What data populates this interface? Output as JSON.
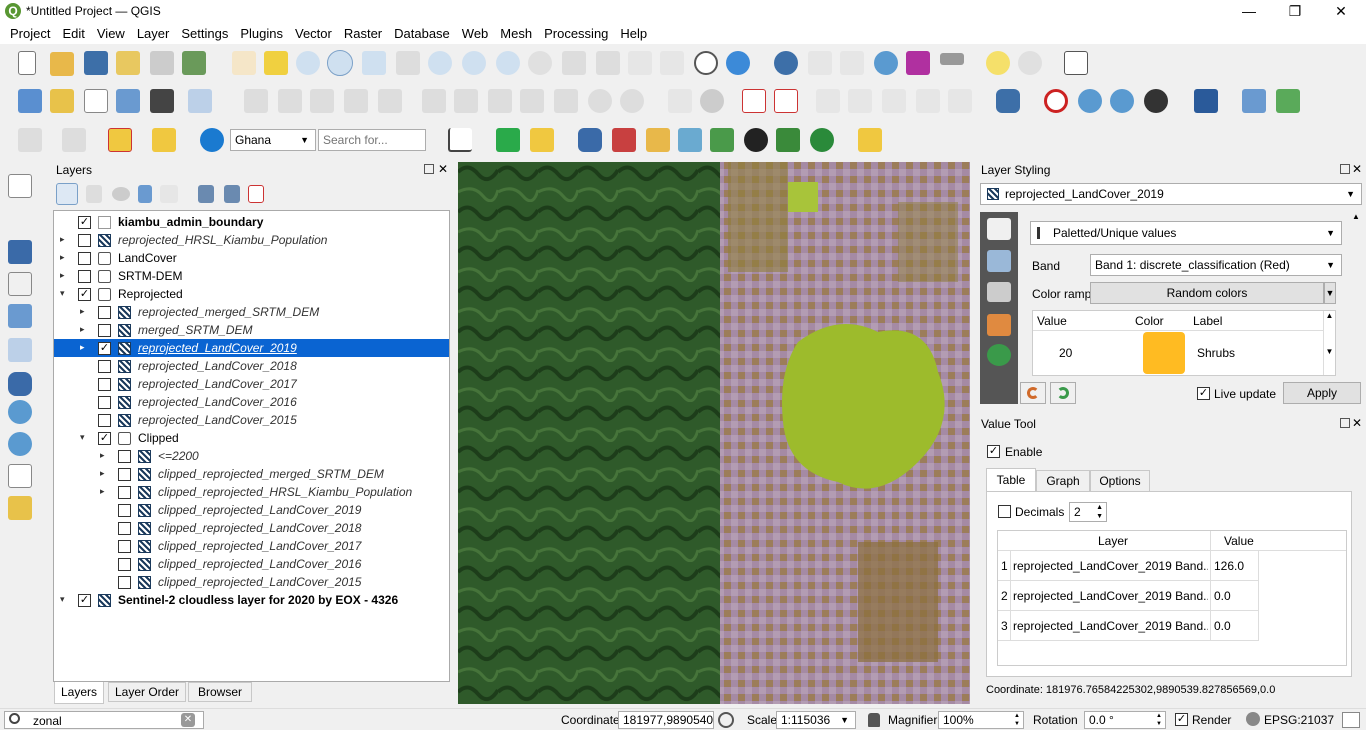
{
  "window": {
    "title": "*Untitled Project — QGIS",
    "logo_letter": "Q",
    "minimize": "—",
    "maximize": "❐",
    "close": "✕"
  },
  "menu": [
    "Project",
    "Edit",
    "View",
    "Layer",
    "Settings",
    "Plugins",
    "Vector",
    "Raster",
    "Database",
    "Web",
    "Mesh",
    "Processing",
    "Help"
  ],
  "toolbar3": {
    "locator_combo": "Ghana",
    "search_placeholder": "Search for..."
  },
  "layers_panel": {
    "title": "Layers",
    "rows": [
      {
        "label": "kiambu_admin_boundary",
        "checked": true,
        "bold": true,
        "italic": false,
        "indent": 0,
        "arrow": "",
        "icon": "vector"
      },
      {
        "label": "reprojected_HRSL_Kiambu_Population",
        "checked": false,
        "bold": false,
        "italic": true,
        "indent": 0,
        "arrow": "▸",
        "icon": "raster"
      },
      {
        "label": "LandCover",
        "checked": false,
        "bold": false,
        "italic": false,
        "indent": 0,
        "arrow": "▸",
        "icon": "group"
      },
      {
        "label": "SRTM-DEM",
        "checked": false,
        "bold": false,
        "italic": false,
        "indent": 0,
        "arrow": "▸",
        "icon": "group"
      },
      {
        "label": "Reprojected",
        "checked": true,
        "bold": false,
        "italic": false,
        "indent": 0,
        "arrow": "▾",
        "icon": "group"
      },
      {
        "label": "reprojected_merged_SRTM_DEM",
        "checked": false,
        "bold": false,
        "italic": true,
        "indent": 1,
        "arrow": "▸",
        "icon": "raster"
      },
      {
        "label": "merged_SRTM_DEM",
        "checked": false,
        "bold": false,
        "italic": true,
        "indent": 1,
        "arrow": "▸",
        "icon": "raster"
      },
      {
        "label": "reprojected_LandCover_2019",
        "checked": true,
        "bold": false,
        "italic": true,
        "indent": 1,
        "arrow": "▸",
        "icon": "raster",
        "selected": true
      },
      {
        "label": "reprojected_LandCover_2018",
        "checked": false,
        "bold": false,
        "italic": true,
        "indent": 1,
        "arrow": "",
        "icon": "raster"
      },
      {
        "label": "reprojected_LandCover_2017",
        "checked": false,
        "bold": false,
        "italic": true,
        "indent": 1,
        "arrow": "",
        "icon": "raster"
      },
      {
        "label": "reprojected_LandCover_2016",
        "checked": false,
        "bold": false,
        "italic": true,
        "indent": 1,
        "arrow": "",
        "icon": "raster"
      },
      {
        "label": "reprojected_LandCover_2015",
        "checked": false,
        "bold": false,
        "italic": true,
        "indent": 1,
        "arrow": "",
        "icon": "raster"
      },
      {
        "label": "Clipped",
        "checked": true,
        "bold": false,
        "italic": false,
        "indent": 1,
        "arrow": "▾",
        "icon": "group"
      },
      {
        "label": "<=2200",
        "checked": false,
        "bold": false,
        "italic": true,
        "indent": 2,
        "arrow": "▸",
        "icon": "raster"
      },
      {
        "label": "clipped_reprojected_merged_SRTM_DEM",
        "checked": false,
        "bold": false,
        "italic": true,
        "indent": 2,
        "arrow": "▸",
        "icon": "raster"
      },
      {
        "label": "clipped_reprojected_HRSL_Kiambu_Population",
        "checked": false,
        "bold": false,
        "italic": true,
        "indent": 2,
        "arrow": "▸",
        "icon": "raster"
      },
      {
        "label": "clipped_reprojected_LandCover_2019",
        "checked": false,
        "bold": false,
        "italic": true,
        "indent": 2,
        "arrow": "",
        "icon": "raster"
      },
      {
        "label": "clipped_reprojected_LandCover_2018",
        "checked": false,
        "bold": false,
        "italic": true,
        "indent": 2,
        "arrow": "",
        "icon": "raster"
      },
      {
        "label": "clipped_reprojected_LandCover_2017",
        "checked": false,
        "bold": false,
        "italic": true,
        "indent": 2,
        "arrow": "",
        "icon": "raster"
      },
      {
        "label": "clipped_reprojected_LandCover_2016",
        "checked": false,
        "bold": false,
        "italic": true,
        "indent": 2,
        "arrow": "",
        "icon": "raster"
      },
      {
        "label": "clipped_reprojected_LandCover_2015",
        "checked": false,
        "bold": false,
        "italic": true,
        "indent": 2,
        "arrow": "",
        "icon": "raster"
      },
      {
        "label": "Sentinel-2 cloudless layer for 2020 by EOX - 4326",
        "checked": true,
        "bold": true,
        "italic": false,
        "indent": 0,
        "arrow": "▾",
        "icon": "raster"
      }
    ],
    "tabs": [
      "Layers",
      "Layer Order",
      "Browser"
    ]
  },
  "styling": {
    "title": "Layer Styling",
    "layer_combo": "reprojected_LandCover_2019",
    "renderer": "Paletted/Unique values",
    "band_label": "Band",
    "band_value": "Band 1: discrete_classification (Red)",
    "ramp_label": "Color ramp",
    "ramp_value": "Random colors",
    "col_value": "Value",
    "col_color": "Color",
    "col_label": "Label",
    "row_value": "20",
    "row_label": "Shrubs",
    "row_color": "#ffbb22",
    "live_update": "Live update",
    "apply": "Apply"
  },
  "value_tool": {
    "title": "Value Tool",
    "enable": "Enable",
    "tabs": [
      "Table",
      "Graph",
      "Options"
    ],
    "decimals_label": "Decimals",
    "decimals_value": "2",
    "col_layer": "Layer",
    "col_value": "Value",
    "rows": [
      {
        "n": "1",
        "layer": "reprojected_LandCover_2019 Band...",
        "value": "126.0"
      },
      {
        "n": "2",
        "layer": "reprojected_LandCover_2019 Band...",
        "value": "0.0"
      },
      {
        "n": "3",
        "layer": "reprojected_LandCover_2019 Band...",
        "value": "0.0"
      }
    ],
    "coordinate": "Coordinate: 181976.76584225302,9890539.827856569,0.0"
  },
  "statusbar": {
    "search_value": "zonal",
    "coordinate_label": "Coordinate",
    "coordinate_value": "181977,9890540",
    "scale_label": "Scale",
    "scale_value": "1:115036",
    "magnifier_label": "Magnifier",
    "magnifier_value": "100%",
    "rotation_label": "Rotation",
    "rotation_value": "0.0 °",
    "render_label": "Render",
    "crs": "EPSG:21037"
  }
}
